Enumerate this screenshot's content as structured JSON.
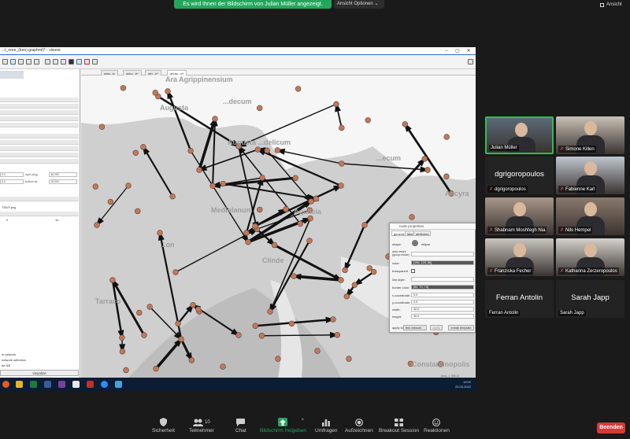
{
  "banner": {
    "share_text": "Es wird Ihnen der Bildschirm von Julian Müller angezeigt.",
    "view_options": "Ansicht Optionen ⌄",
    "view_label": "Ansicht"
  },
  "app": {
    "window_title": "...t_nore_(bnn).graphml)* - visone",
    "tabs": [
      "wrko..tc",
      "wrko...tr*",
      "atrr...tr*",
      "ahuto...tr*"
    ],
    "left_panel": {
      "fields": {
        "a": "0.0",
        "b": "48.299",
        "c": "0.0",
        "d": "18.000"
      },
      "labels": {
        "a": "right (deg)",
        "b": "bottom lat"
      },
      "path": "TS0/Y.png",
      "n1": "0",
      "n2": "10",
      "bottom": [
        "in network",
        "network selection",
        "tsr NB"
      ],
      "visualize": "visualize"
    },
    "places": [
      "Ara Agrippinensium",
      "Augusta",
      "...decum",
      "Augusta ...delicum",
      "...ecum",
      "Mediolanum",
      "Aquileia",
      "Clinde",
      "Tarraco",
      "...on",
      "Constantinopolis",
      "Ancyra"
    ],
    "node_properties": {
      "title": "node properties",
      "tabs": [
        "general",
        "label",
        "attributes"
      ],
      "rows": [
        {
          "label": "shape:",
          "value": "ellipse"
        },
        {
          "label": "auto resize (group mode)",
          "value": ""
        },
        {
          "label": "color:",
          "value": "[196, 120, 86]"
        },
        {
          "label": "transparent",
          "value": ""
        },
        {
          "label": "line style:",
          "value": ""
        },
        {
          "label": "border color:",
          "value": "[80, 70, 70]"
        },
        {
          "label": "x-coordinate:",
          "value": "0.0"
        },
        {
          "label": "y-coordinate:",
          "value": "0.0"
        },
        {
          "label": "width:",
          "value": "30.0"
        },
        {
          "label": "height:",
          "value": "30.0"
        }
      ],
      "apply_to_label": "apply to:",
      "apply_to_value": "this network",
      "apply_btn": "apply",
      "template_btn": "create template"
    },
    "status_coords": "(sm(...), 300.1)",
    "taskbar": {
      "time": "19:02",
      "date": "22.03.2022"
    }
  },
  "participants": [
    {
      "name": "Julian Müller",
      "active": true,
      "muted": false,
      "video": true
    },
    {
      "name": "Simone Killen",
      "muted": true,
      "video": true
    },
    {
      "name": "dgrigoropoulos",
      "muted": true,
      "video": false
    },
    {
      "name": "Fabienne Karl",
      "muted": true,
      "video": true
    },
    {
      "name": "Shabnam Moshfegh Nia",
      "muted": true,
      "video": true
    },
    {
      "name": "Nils Hempel",
      "muted": true,
      "video": true
    },
    {
      "name": "Franziska Fecher",
      "muted": true,
      "video": true
    },
    {
      "name": "Katharina Zerzeropoulos",
      "muted": true,
      "video": true
    },
    {
      "name": "Ferran Antolin",
      "muted": false,
      "video": false
    },
    {
      "name": "Sarah Japp",
      "muted": false,
      "video": false
    }
  ],
  "controls": {
    "security": "Sicherheit",
    "participants": "Teilnehmer",
    "participants_count": "10",
    "chat": "Chat",
    "share": "Bildschirm freigeben",
    "polls": "Umfragen",
    "record": "Aufzeichnen",
    "breakout": "Breakout Session",
    "reactions": "Reaktionen",
    "end": "Beenden"
  },
  "colors": {
    "accent_green": "#23a65b",
    "end_red": "#d83838",
    "node_fill": "#c47856",
    "node_border": "#504646"
  }
}
